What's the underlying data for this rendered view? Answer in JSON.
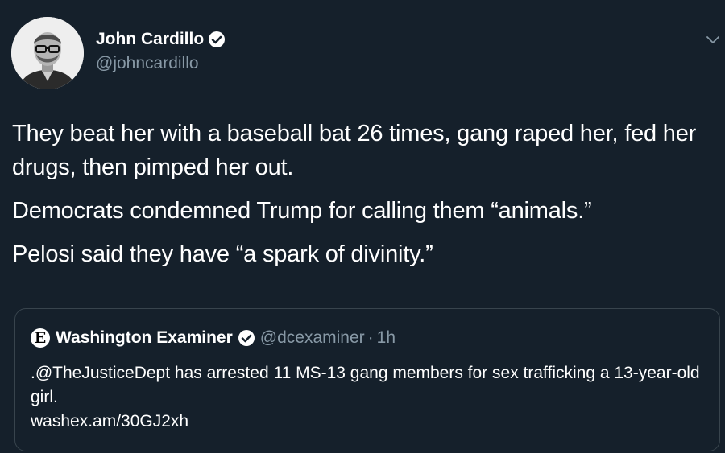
{
  "author": {
    "display_name": "John Cardillo",
    "handle": "@johncardillo",
    "verified": true,
    "avatar_icon": "avatar-photo"
  },
  "tweet": {
    "paragraphs": [
      "They beat her with a baseball bat 26 times, gang raped her, fed her drugs, then pimped her out.",
      "Democrats condemned Trump for calling them “animals.”",
      "Pelosi said they have “a spark of divinity.”"
    ],
    "menu_icon": "chevron-down-icon"
  },
  "quoted_tweet": {
    "logo_glyph": "E",
    "display_name": "Washington Examiner",
    "verified": true,
    "handle": "@dcexaminer",
    "separator": "·",
    "time": "1h",
    "body": ".@TheJusticeDept has arrested 11 MS-13 gang members for sex trafficking a 13-year-old girl.",
    "link": "washex.am/30GJ2xh"
  },
  "colors": {
    "background": "#15202b",
    "text": "#ffffff",
    "secondary_text": "#8899a6",
    "border": "#38444d"
  }
}
